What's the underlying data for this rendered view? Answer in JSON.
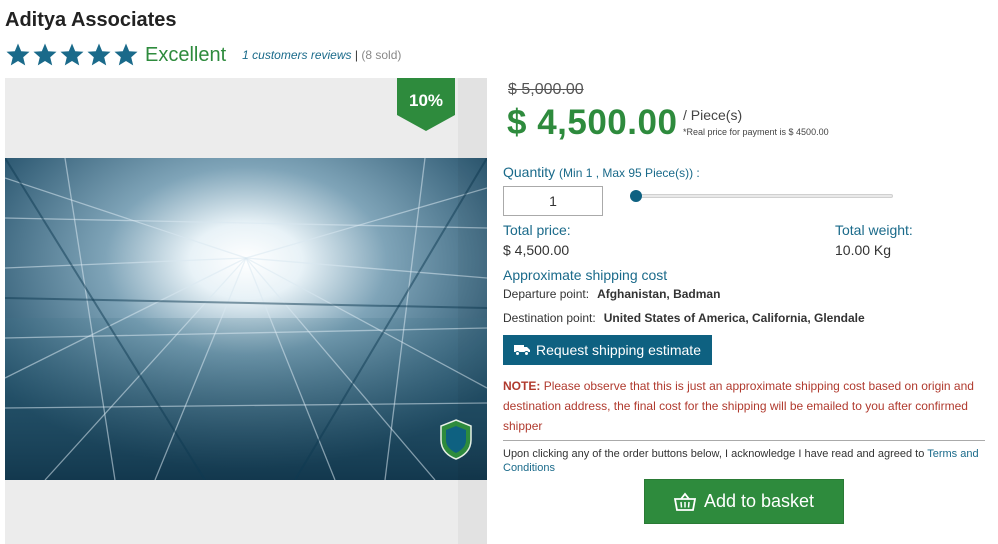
{
  "store": {
    "title": "Aditya Associates"
  },
  "rating": {
    "stars": 5,
    "word": "Excellent",
    "reviews_link": "1 customers reviews",
    "separator": "|",
    "sold": "(8 sold)"
  },
  "image": {
    "discount_badge": "10%"
  },
  "pricing": {
    "old_price": "$ 5,000.00",
    "price": "$ 4,500.00",
    "unit": "/ Piece(s)",
    "real_price_note": "*Real price for payment is $ 4500.00"
  },
  "quantity": {
    "label": "Quantity",
    "range": "(Min 1 , Max 95 Piece(s)) :",
    "value": "1",
    "slider_min": 1,
    "slider_max": 95,
    "slider_value": 1
  },
  "totals": {
    "price_label": "Total price:",
    "price_value": "$ 4,500.00",
    "weight_label": "Total weight:",
    "weight_value": "10.00 Kg"
  },
  "shipping": {
    "heading": "Approximate shipping cost",
    "departure_label": "Departure point:",
    "departure_value": "Afghanistan, Badman",
    "destination_label": "Destination point:",
    "destination_value": "United States of America, California, Glendale",
    "button_label": "Request shipping estimate"
  },
  "note": {
    "label": "NOTE:",
    "text": "Please observe that this is just an approximate shipping cost based on origin and destination address, the final cost for the shipping will be emailed to you after confirmed shipper"
  },
  "terms": {
    "text": "Upon clicking any of the order buttons below, I acknowledge I have read and agreed to",
    "link": "Terms and Conditions"
  },
  "actions": {
    "basket_label": "Add to basket"
  },
  "colors": {
    "accent_blue": "#0e6181",
    "price_green": "#2e8b3d",
    "note_red": "#b03a2e",
    "star_blue": "#1a6a8a"
  },
  "icons": {
    "star": "star-icon",
    "truck": "truck-icon",
    "basket": "basket-icon",
    "logo": "shield-logo-icon"
  }
}
